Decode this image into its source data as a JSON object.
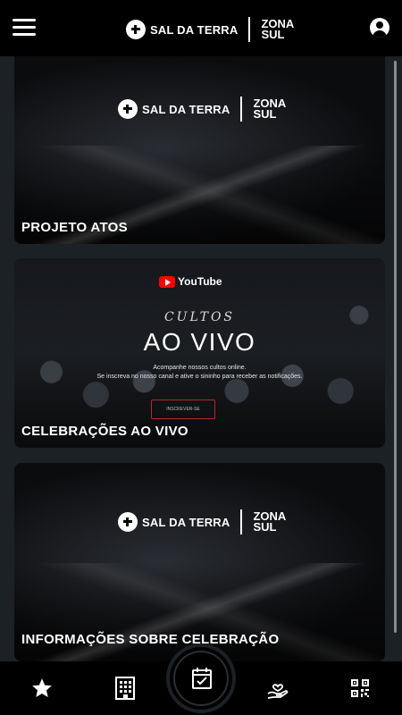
{
  "header": {
    "logo": {
      "name": "SAL DA TERRA",
      "zona_line1": "ZONA",
      "zona_line2": "SUL"
    },
    "icons": {
      "menu": "hamburger-menu-icon",
      "profile": "account-circle-icon"
    }
  },
  "cards": [
    {
      "title": "PROJETO ATOS",
      "logo": {
        "name": "SAL DA TERRA",
        "zona_line1": "ZONA",
        "zona_line2": "SUL"
      }
    },
    {
      "title": "CELEBRAÇÕES AO VIVO",
      "youtube_label": "YouTube",
      "cultos_label": "CULTOS",
      "aovivo_label": "AO VIVO",
      "subtitle_line1": "Acompanhe nossos cultos online.",
      "subtitle_line2": "Se inscreva no nosso canal e ative o sininho para receber as notificações.",
      "subscribe_label": "INSCREVER-SE"
    },
    {
      "title": "INFORMAÇÕES SOBRE CELEBRAÇÃO",
      "logo": {
        "name": "SAL DA TERRA",
        "zona_line1": "ZONA",
        "zona_line2": "SUL"
      }
    }
  ],
  "bottom_nav": {
    "items": [
      "star-icon",
      "building-icon",
      "calendar-check-icon",
      "hand-heart-icon",
      "qr-code-icon"
    ]
  },
  "colors": {
    "background": "#1c2126",
    "bar": "#000000",
    "youtube_red": "#ff0000"
  }
}
